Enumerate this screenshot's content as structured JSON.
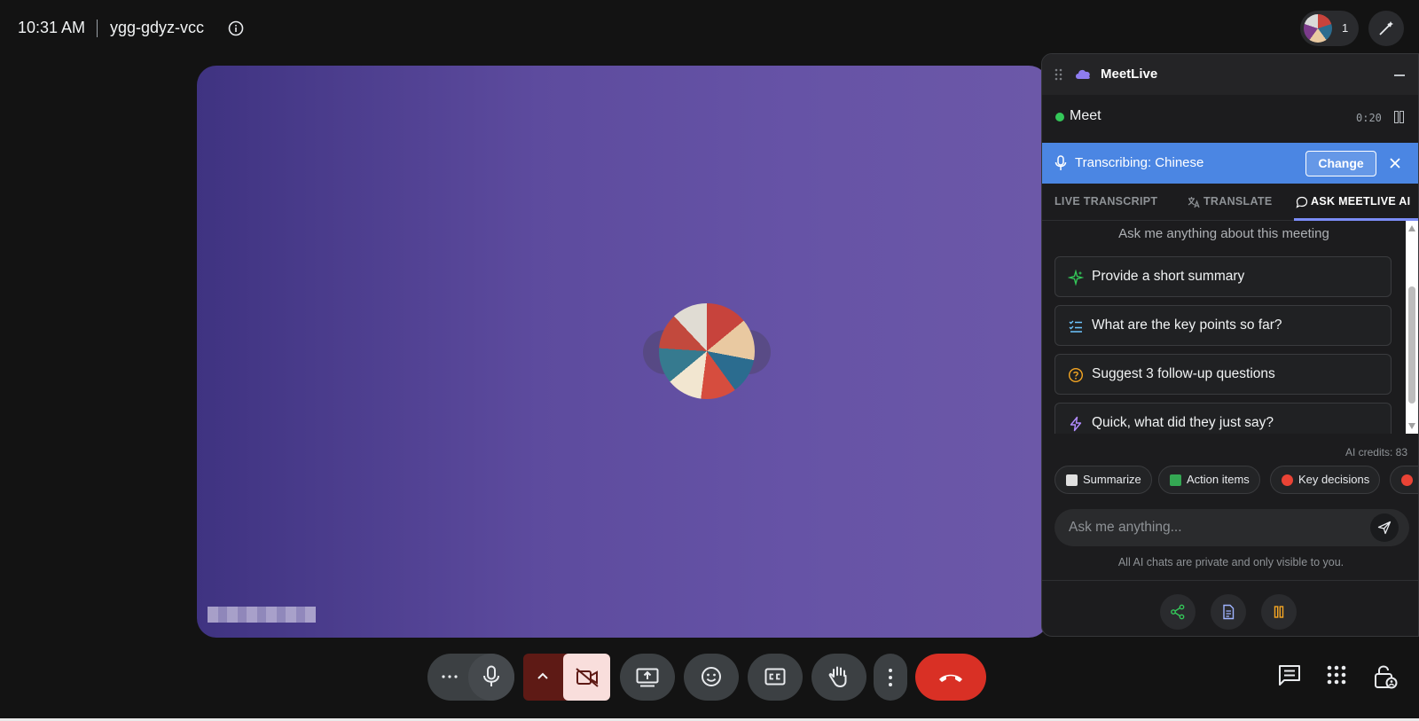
{
  "topbar": {
    "time": "10:31 AM",
    "meeting_code": "ygg-gdyz-vcc",
    "participant_count": "1"
  },
  "panel": {
    "title": "MeetLive",
    "meet_label": "Meet",
    "timer": "0:20",
    "banner_text": "Transcribing: Chinese",
    "change_label": "Change",
    "tabs": [
      "LIVE TRANSCRIPT",
      "TRANSLATE",
      "ASK MEETLIVE AI"
    ],
    "active_tab": "ASK MEETLIVE AI",
    "ask_prompt": "Ask me anything about this meeting",
    "suggestions": [
      {
        "label": "Provide a short summary",
        "icon": "sparkle-icon",
        "color": "#34c759"
      },
      {
        "label": "What are the key points so far?",
        "icon": "checklist-icon",
        "color": "#6ec6ff"
      },
      {
        "label": "Suggest 3 follow-up questions",
        "icon": "question-icon",
        "color": "#f5a623"
      },
      {
        "label": "Quick, what did they just say?",
        "icon": "bolt-icon",
        "color": "#b28cff"
      }
    ],
    "credits": "AI credits: 83",
    "chips": [
      {
        "label": "Summarize",
        "icon": "clipboard-icon",
        "color": "#e0e0e0"
      },
      {
        "label": "Action items",
        "icon": "checkbox-icon",
        "color": "#34a853"
      },
      {
        "label": "Key decisions",
        "icon": "target-icon",
        "color": "#ea4335"
      }
    ],
    "input_placeholder": "Ask me anything...",
    "privacy_note": "All AI chats are private and only visible to you."
  },
  "colors": {
    "accent_blue": "#4b86e3",
    "hangup_red": "#d93025",
    "live_green": "#34c759",
    "pause_orange": "#f5a623"
  }
}
